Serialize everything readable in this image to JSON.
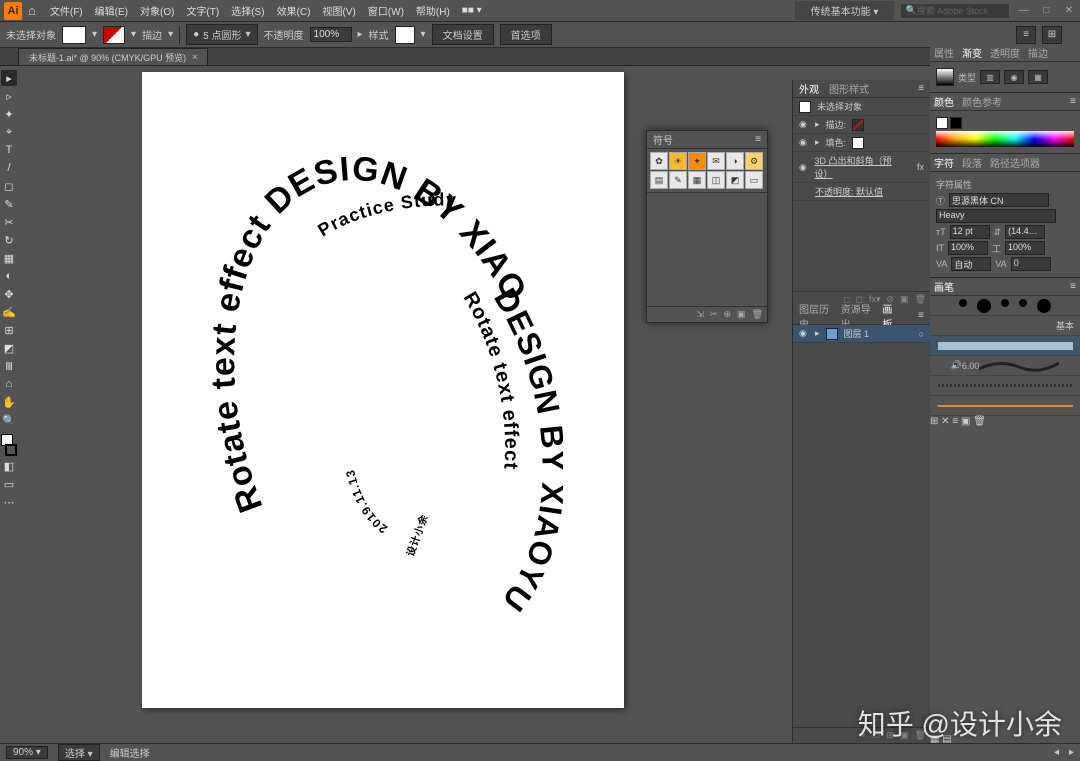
{
  "app": {
    "logo": "Ai",
    "name": "传统基本功能"
  },
  "menu": [
    "文件(F)",
    "编辑(E)",
    "对象(O)",
    "文字(T)",
    "选择(S)",
    "效果(C)",
    "视图(V)",
    "窗口(W)",
    "帮助(H)"
  ],
  "search_placeholder": "搜索 Adobe Stock",
  "optbar": {
    "no_sel": "未选择对象",
    "stroke_label": "描边",
    "stroke_menu": "▾",
    "stroke_weight": "5 点圆形",
    "opacity_label": "不透明度",
    "opacity_val": "100%",
    "style_label": "样式",
    "doc_setup": "文档设置",
    "prefs": "首选项"
  },
  "doc_tab": {
    "title": "未标题-1.ai* @ 90% (CMYK/GPU 预览)",
    "close": "×"
  },
  "tools": [
    "▸",
    "▹",
    "✦",
    "⌖",
    "T",
    "/",
    "◻",
    "✎",
    "✂",
    "↻",
    "▦",
    "◐",
    "✥",
    "✍",
    "⊞",
    "◩",
    "Ⅲ",
    "⌂",
    "✋",
    "🔍"
  ],
  "artwork": {
    "outer": "Rotate text effect DESIGN BY XIAO",
    "inner_top": "Practice Study",
    "inner_main": "DESIGN BY XIAOYU",
    "inner_sub": "Rotate text effect",
    "date": "2019.11.13",
    "cn": "设计小余"
  },
  "symbols_panel": {
    "title": "符号"
  },
  "appearance": {
    "tabs": [
      "外观",
      "图形样式"
    ],
    "title": "未选择对象",
    "stroke": "描边:",
    "fill": "填色:",
    "fx": "3D 凸出和斜角（预设）",
    "opacity": "不透明度: 默认值"
  },
  "layers": {
    "tabs": [
      "图层历史",
      "资源导出",
      "画板"
    ],
    "layer1": "图层 1"
  },
  "right": {
    "tabs_top": [
      "属性",
      "渐变",
      "透明度",
      "描边"
    ],
    "grad_label": "类型",
    "color_tabs": [
      "颜色",
      "颜色参考"
    ],
    "char_tabs": [
      "字符",
      "段落",
      "路径选项器"
    ],
    "char_header": "字符属性",
    "font": "思源黑体 CN",
    "weight": "Heavy",
    "size": "12 pt",
    "leading": "(14.4…",
    "tracking": "100%",
    "tracking2": "100%",
    "va": "0",
    "auto": "自动",
    "brush_tab": "画笔",
    "brush_basic": "基本",
    "brush_size": "6.00"
  },
  "status": {
    "zoom": "90%",
    "tool": "选择",
    "mode": "编辑选择"
  },
  "watermark": "知乎 @设计小余"
}
